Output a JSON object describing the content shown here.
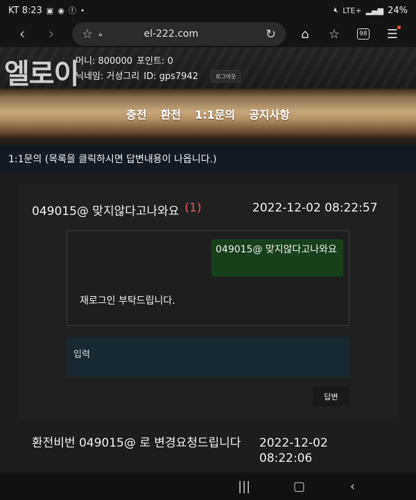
{
  "status_bar": {
    "carrier_time": "KT 8:23",
    "battery": "24%",
    "network": "LTE+"
  },
  "browser": {
    "url": "el-222.com",
    "tab_count": "98"
  },
  "header": {
    "logo": "엘로이",
    "money": "머니: 800000",
    "points": "포인트: 0",
    "nickname": "닉네임: 거성그리",
    "user_id": "ID: gps7942",
    "logout": "로그아웃"
  },
  "menu": {
    "items": [
      {
        "label": "충전"
      },
      {
        "label": "환전"
      },
      {
        "label": "1:1문의"
      },
      {
        "label": "공지사항"
      }
    ]
  },
  "page": {
    "title": "1:1문의  (목록을 클릭하시면 답변내용이 나옵니다.)"
  },
  "inquiries": [
    {
      "subject": "049015@ 맞지않다고나와요",
      "count": "(1)",
      "date": "2022-12-02 08:22:57",
      "message": "049015@ 맞지않다고나와요",
      "reply": "재로그인 부탁드립니다.",
      "input_placeholder": "입력",
      "reply_button": "답변"
    },
    {
      "subject": "환전비번 049015@ 로 변경요청드립니다",
      "date": "2022-12-02 08:22:06"
    }
  ],
  "colors": {
    "gold": "#c6a779",
    "bubble": "#173f1c",
    "count_red": "#e25a5a",
    "input_bg": "#182830"
  }
}
